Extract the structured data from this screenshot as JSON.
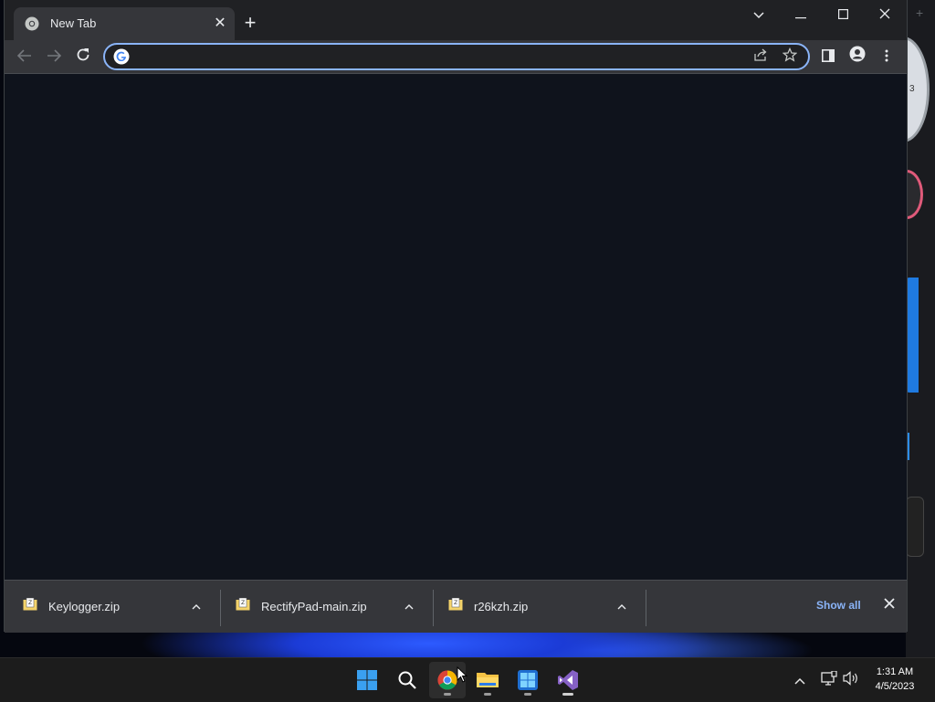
{
  "browser": {
    "tab": {
      "title": "New Tab"
    },
    "omnibox": {
      "value": "",
      "placeholder": ""
    }
  },
  "downloads": {
    "items": [
      {
        "name": "Keylogger.zip"
      },
      {
        "name": "RectifyPad-main.zip"
      },
      {
        "name": "r26kzh.zip"
      }
    ],
    "show_all_label": "Show all"
  },
  "taskbar": {
    "apps": [
      "start-icon",
      "search-icon",
      "chrome-icon",
      "file-explorer-icon",
      "windows-app-icon",
      "visual-studio-icon"
    ],
    "clock": {
      "time": "1:31 AM",
      "date": "4/5/2023"
    }
  },
  "colors": {
    "accent": "#8ab4f8",
    "tab_bg": "#35363a",
    "titlebar_bg": "#202124",
    "content_bg": "#0f131c",
    "taskbar_bg": "#1c1c1c"
  }
}
